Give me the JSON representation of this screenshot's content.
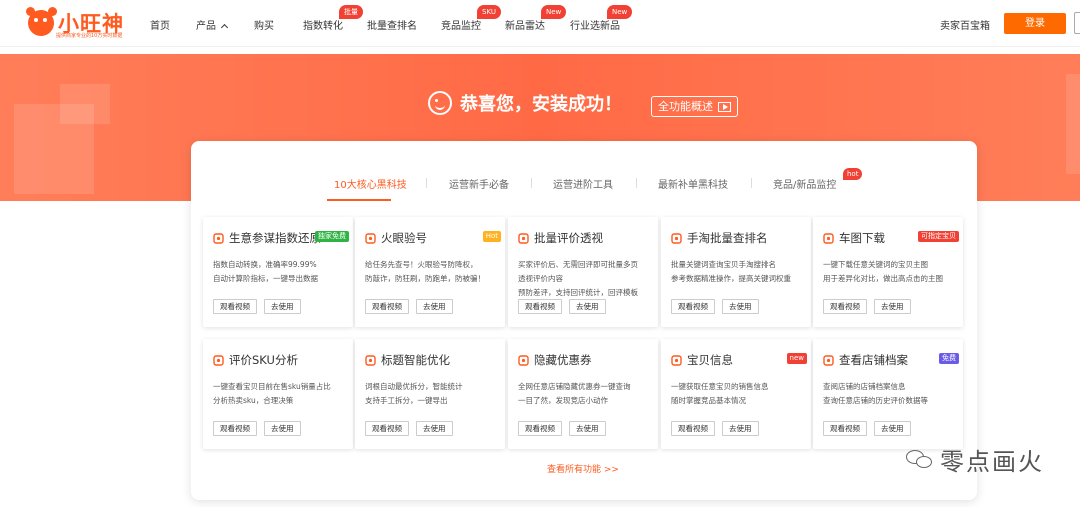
{
  "nav": {
    "logo_text": "小旺神",
    "logo_sub": "提供商家专业的10万实时数据",
    "items": [
      {
        "label": "首页"
      },
      {
        "label": "产品"
      },
      {
        "label": "购买"
      },
      {
        "label": "指数转化",
        "badge": "批量"
      },
      {
        "label": "批量查排名"
      },
      {
        "label": "竞品监控",
        "badge": "SKU"
      },
      {
        "label": "新品雷达",
        "badge": "New"
      },
      {
        "label": "行业选新品",
        "badge": "New"
      }
    ],
    "seller": "卖家百宝箱",
    "login": "登录"
  },
  "hero": {
    "title": "恭喜您，安装成功！",
    "button": "全功能概述"
  },
  "tabs": [
    {
      "label": "10大核心黑科技"
    },
    {
      "label": "运营新手必备"
    },
    {
      "label": "运营进阶工具"
    },
    {
      "label": "最新补单黑科技"
    },
    {
      "label": "竞品/新品监控",
      "badge": "hot"
    }
  ],
  "cards": [
    {
      "title": "生意参谋指数还原",
      "icon": "key-icon",
      "badge": "独家免费",
      "badge_color": "#2fb343",
      "desc": [
        "指数自动转换，准确率99.99%",
        "自动计算阶指标，一键导出数据"
      ]
    },
    {
      "title": "火眼验号",
      "icon": "eye-icon",
      "badge": "Hot",
      "badge_color": "#ffb11f",
      "desc": [
        "给任务先查号！火眼验号防降权，",
        "防敲诈，防狂刷，防跑单，防被骗！"
      ]
    },
    {
      "title": "批量评价透视",
      "icon": "shield-icon",
      "badge": "",
      "badge_color": "",
      "desc": [
        "买家评价后、无需回评即可批量多页",
        "透视评价内容",
        "预防差评，支持回评统计，回评模板"
      ]
    },
    {
      "title": "手淘批量查排名",
      "icon": "trophy-icon",
      "badge": "",
      "badge_color": "",
      "desc": [
        "批量关键词查询宝贝手淘搜排名",
        "参考数据精准操作，提高关键词权重"
      ]
    },
    {
      "title": "车图下载",
      "icon": "image-icon",
      "badge": "可指定宝贝",
      "badge_color": "#f04134",
      "desc": [
        "一键下载任意关键词的宝贝主图",
        "用于差异化对比，做出高点击的主图"
      ]
    },
    {
      "title": "评价SKU分析",
      "icon": "sku-icon",
      "badge": "",
      "badge_color": "",
      "desc": [
        "一键查看宝贝目前在售sku销量占比",
        "分析热卖sku，合理决策"
      ]
    },
    {
      "title": "标题智能优化",
      "icon": "edit-icon",
      "badge": "",
      "badge_color": "",
      "desc": [
        "词根自动最优拆分，智能统计",
        "支持手工拆分，一键导出"
      ]
    },
    {
      "title": "隐藏优惠券",
      "icon": "coupon-icon",
      "badge": "",
      "badge_color": "",
      "desc": [
        "全网任意店铺隐藏优惠券一键查询",
        "一目了然，发现竞店小动作"
      ]
    },
    {
      "title": "宝贝信息",
      "icon": "picture-icon",
      "badge": "new",
      "badge_color": "#f04134",
      "desc": [
        "一键获取任意宝贝的销售信息",
        "随时掌握竞品基本情况"
      ]
    },
    {
      "title": "查看店铺档案",
      "icon": "archive-icon",
      "badge": "免费",
      "badge_color": "#6b5ce7",
      "desc": [
        "查阅店铺的店铺档案信息",
        "查询任意店铺的历史评价数据等"
      ]
    }
  ],
  "buttons": {
    "video": "观看视频",
    "use": "去使用"
  },
  "see_all": "查看所有功能 >>",
  "watermark": "零点画火",
  "colors": {
    "accent": "#ff5a1f",
    "hero": "#ff6a45",
    "login": "#ff6a00"
  }
}
